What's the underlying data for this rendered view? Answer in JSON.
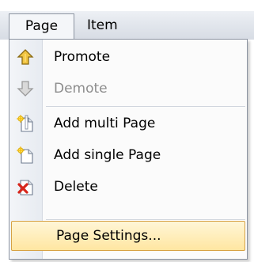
{
  "menubar": {
    "tabs": [
      "Page",
      "Item"
    ]
  },
  "dropdown": {
    "items": [
      {
        "label": "Promote",
        "icon": "promote-arrow-icon",
        "enabled": true
      },
      {
        "label": "Demote",
        "icon": "demote-arrow-icon",
        "enabled": false
      },
      {
        "label": "Add multi Page",
        "icon": "add-multi-page-icon",
        "enabled": true
      },
      {
        "label": "Add single Page",
        "icon": "add-single-page-icon",
        "enabled": true
      },
      {
        "label": "Delete",
        "icon": "delete-icon",
        "enabled": true
      },
      {
        "label": "Page Settings...",
        "icon": "",
        "enabled": true,
        "highlighted": true
      }
    ]
  },
  "colors": {
    "highlight_border": "#d7a245",
    "highlight_fill": "#ffe6a1",
    "menu_border": "#8b93a0",
    "disabled_text": "#8d8d8d",
    "delete_red": "#d7261c"
  }
}
